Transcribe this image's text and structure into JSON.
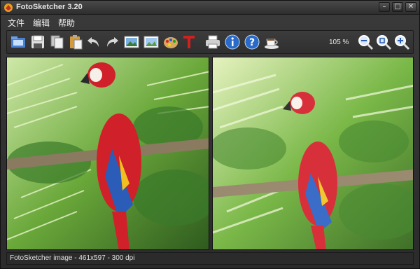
{
  "window": {
    "title": "FotoSketcher 3.20"
  },
  "menu": {
    "items": [
      "文件",
      "编辑",
      "帮助"
    ]
  },
  "toolbar": {
    "icons": [
      "open-icon",
      "save-icon",
      "copy-icon",
      "paste-icon",
      "undo-icon",
      "redo-icon",
      "image-original-icon",
      "image-result-icon",
      "palette-icon",
      "text-icon",
      "print-icon",
      "info-icon",
      "help-icon",
      "coffee-icon",
      "zoom-out-icon",
      "zoom-fit-icon",
      "zoom-in-icon"
    ],
    "zoom_level": "105 %"
  },
  "status": {
    "text": "FotoSketcher image - 461x597 - 300 dpi"
  },
  "colors": {
    "background": "#2b2b2b",
    "text": "#e8e8e8",
    "parrot_red": "#d0202a",
    "parrot_blue": "#2a5cb8",
    "foliage": "#5a9a3a"
  }
}
